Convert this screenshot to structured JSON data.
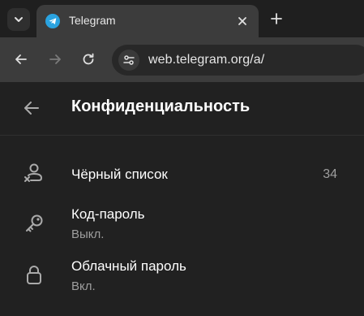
{
  "browser": {
    "tab_title": "Telegram",
    "url": "web.telegram.org/a/"
  },
  "header": {
    "title": "Конфиденциальность"
  },
  "settings": [
    {
      "title": "Чёрный список",
      "value": "34",
      "icon": "blocked-user-icon"
    },
    {
      "title": "Код-пароль",
      "subtitle": "Выкл.",
      "icon": "key-icon"
    },
    {
      "title": "Облачный пароль",
      "subtitle": "Вкл.",
      "icon": "lock-icon"
    }
  ],
  "colors": {
    "background": "#212121",
    "text_primary": "#ffffff",
    "text_secondary": "#9e9e9e",
    "telegram_blue": "#2aa3e0"
  }
}
